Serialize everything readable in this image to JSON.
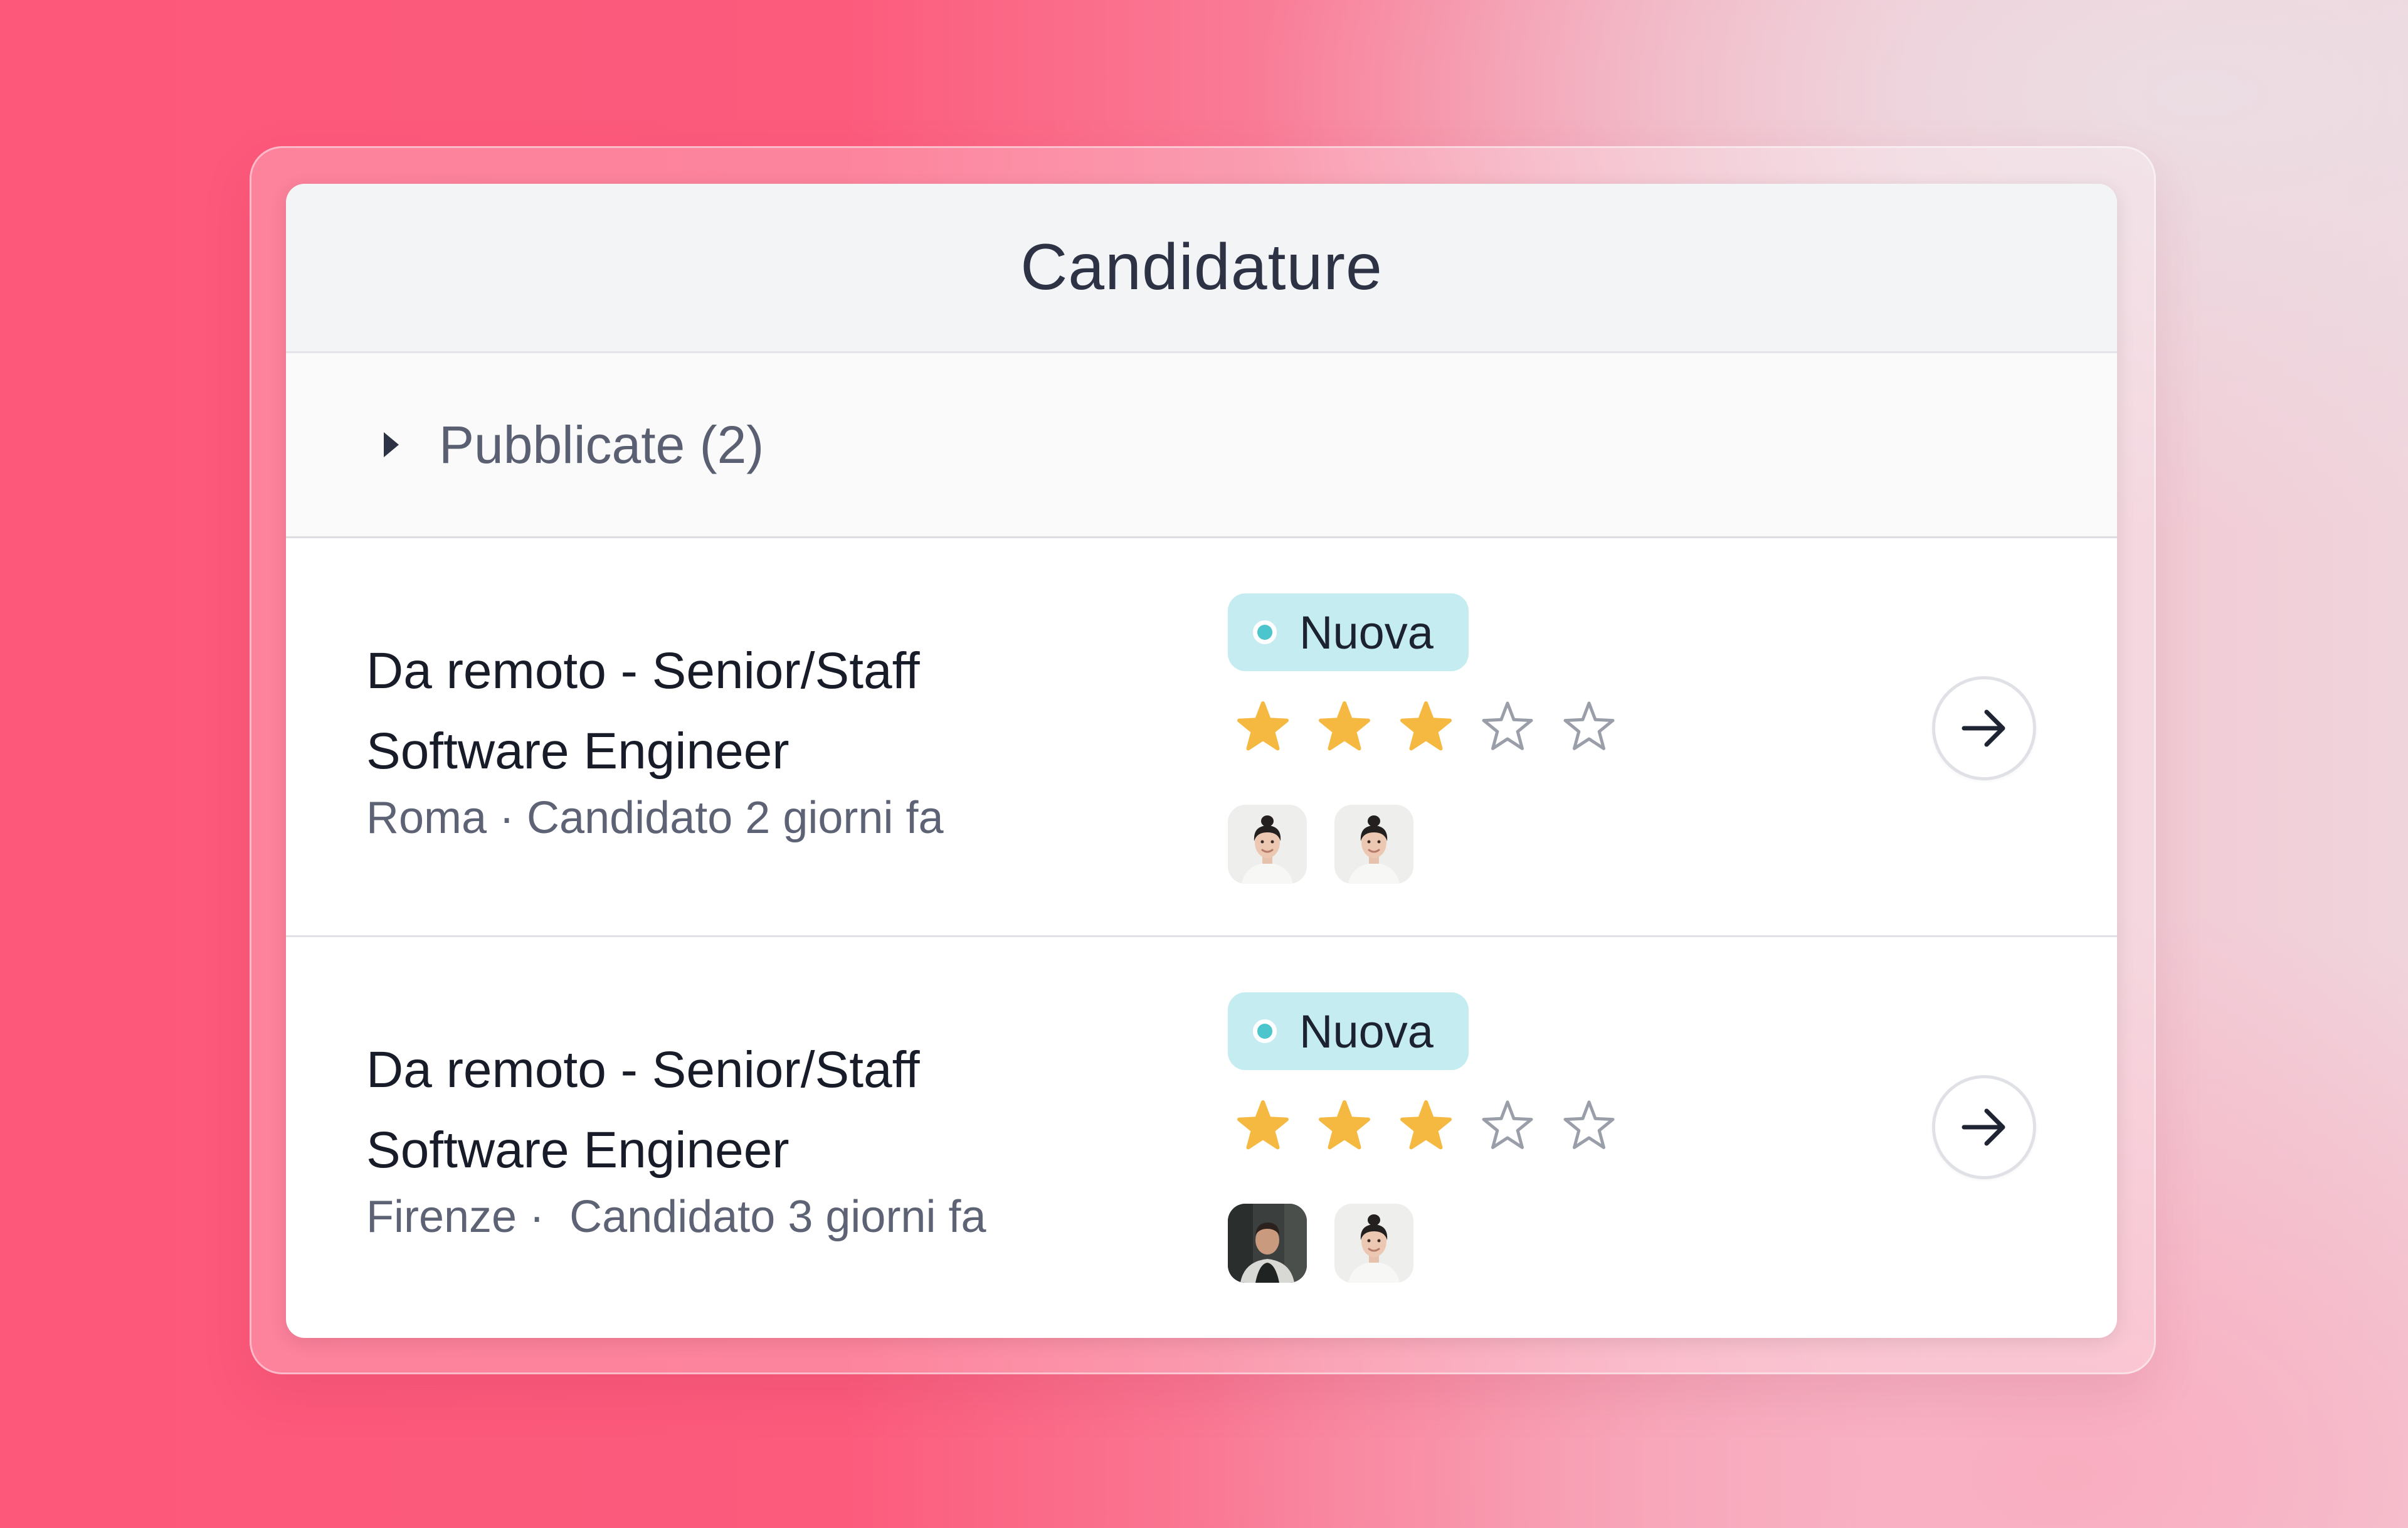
{
  "panel": {
    "title": "Candidature"
  },
  "section": {
    "label": "Pubblicate (2)",
    "expanded": false
  },
  "applications": [
    {
      "title_line1": "Da remoto - Senior/Staff",
      "title_line2": "Software Engineer",
      "meta": "Roma · Candidato 2 giorni fa",
      "status": "Nuova",
      "rating": 3,
      "rating_max": 5,
      "avatars": [
        "avatar-woman",
        "avatar-woman"
      ]
    },
    {
      "title_line1": "Da remoto - Senior/Staff",
      "title_line2": "Software Engineer",
      "meta": "Firenze ·  Candidato 3 giorni fa",
      "status": "Nuova",
      "rating": 3,
      "rating_max": 5,
      "avatars": [
        "avatar-man",
        "avatar-woman"
      ]
    }
  ],
  "colors": {
    "star_filled": "#f5b942",
    "star_empty": "#9a9ea8",
    "badge_bg": "#c5edf1",
    "badge_dot": "#4cc5cc",
    "background_pink": "#fd587a"
  }
}
